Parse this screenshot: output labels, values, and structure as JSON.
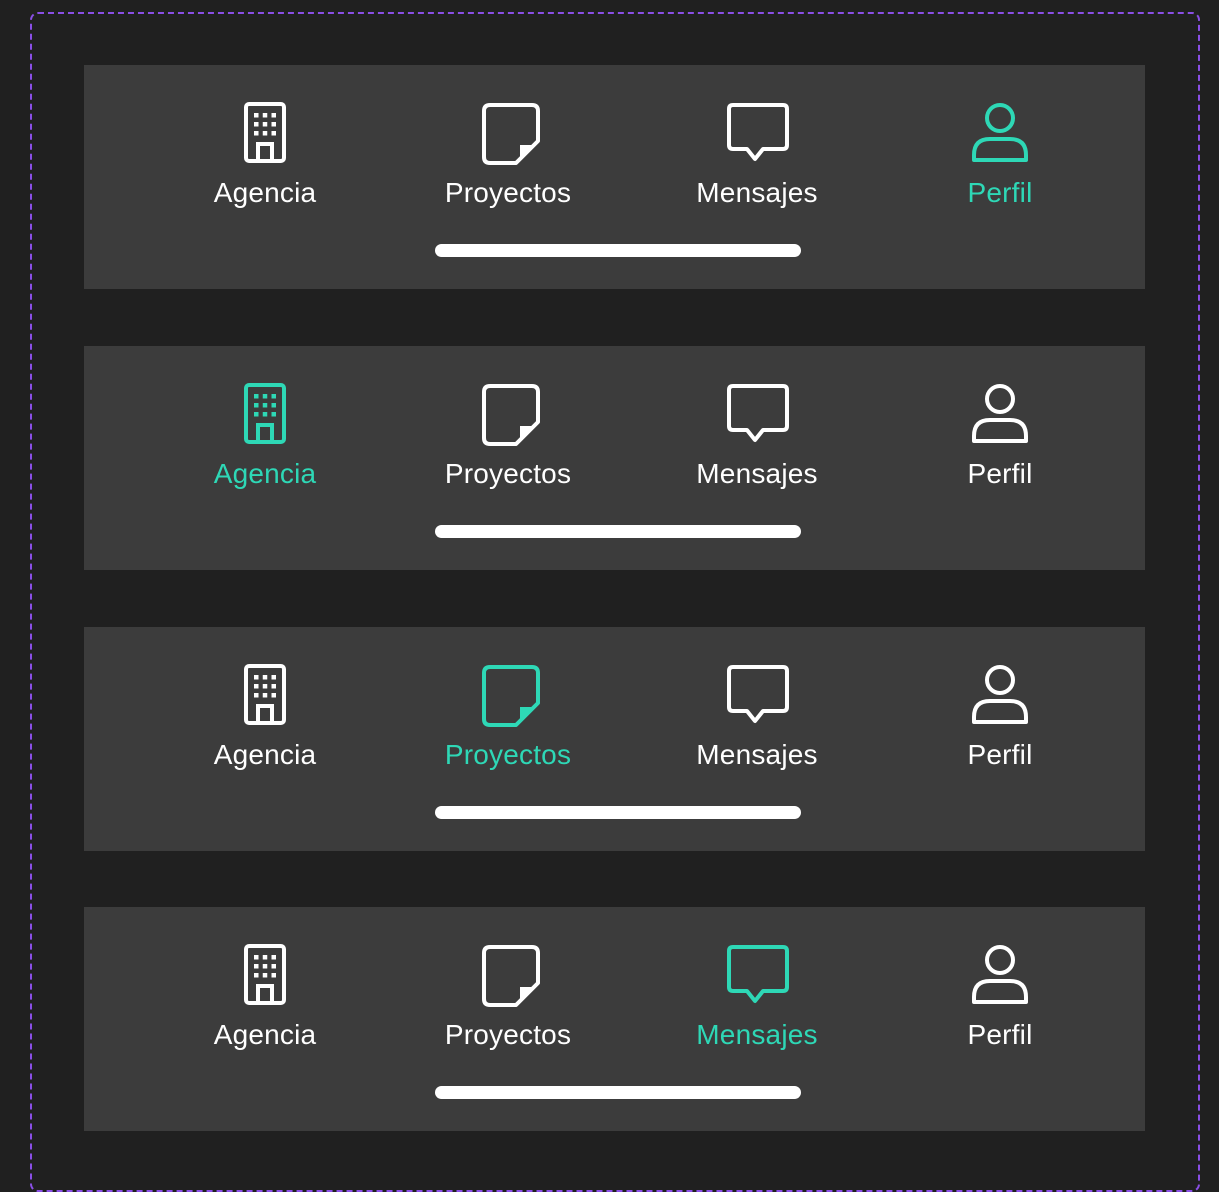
{
  "colors": {
    "background": "#202020",
    "bar_background": "#3c3c3c",
    "frame_border": "#8a4fe6",
    "inactive": "#ffffff",
    "active": "#2ed8b6"
  },
  "tab_bars": [
    {
      "active_tab": "perfil",
      "tabs": [
        {
          "id": "agencia",
          "label": "Agencia",
          "icon": "building-icon"
        },
        {
          "id": "proyectos",
          "label": "Proyectos",
          "icon": "note-icon"
        },
        {
          "id": "mensajes",
          "label": "Mensajes",
          "icon": "chat-bubble-icon"
        },
        {
          "id": "perfil",
          "label": "Perfil",
          "icon": "person-icon"
        }
      ]
    },
    {
      "active_tab": "agencia",
      "tabs": [
        {
          "id": "agencia",
          "label": "Agencia",
          "icon": "building-icon"
        },
        {
          "id": "proyectos",
          "label": "Proyectos",
          "icon": "note-icon"
        },
        {
          "id": "mensajes",
          "label": "Mensajes",
          "icon": "chat-bubble-icon"
        },
        {
          "id": "perfil",
          "label": "Perfil",
          "icon": "person-icon"
        }
      ]
    },
    {
      "active_tab": "proyectos",
      "tabs": [
        {
          "id": "agencia",
          "label": "Agencia",
          "icon": "building-icon"
        },
        {
          "id": "proyectos",
          "label": "Proyectos",
          "icon": "note-icon"
        },
        {
          "id": "mensajes",
          "label": "Mensajes",
          "icon": "chat-bubble-icon"
        },
        {
          "id": "perfil",
          "label": "Perfil",
          "icon": "person-icon"
        }
      ]
    },
    {
      "active_tab": "mensajes",
      "tabs": [
        {
          "id": "agencia",
          "label": "Agencia",
          "icon": "building-icon"
        },
        {
          "id": "proyectos",
          "label": "Proyectos",
          "icon": "note-icon"
        },
        {
          "id": "mensajes",
          "label": "Mensajes",
          "icon": "chat-bubble-icon"
        },
        {
          "id": "perfil",
          "label": "Perfil",
          "icon": "person-icon"
        }
      ]
    }
  ]
}
